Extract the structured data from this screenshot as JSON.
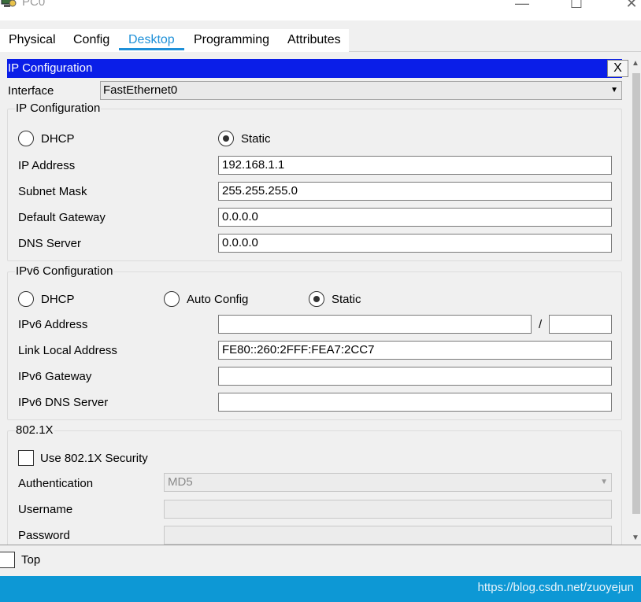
{
  "window": {
    "title": "PC0",
    "minimize_glyph": "—",
    "maximize_glyph": "☐",
    "close_glyph": "✕"
  },
  "tabs": [
    {
      "label": "Physical"
    },
    {
      "label": "Config"
    },
    {
      "label": "Desktop",
      "active": true
    },
    {
      "label": "Programming"
    },
    {
      "label": "Attributes"
    }
  ],
  "panel": {
    "title": "IP Configuration",
    "close_label": "X"
  },
  "interface": {
    "label": "Interface",
    "value": "FastEthernet0"
  },
  "ipv4": {
    "legend": "IP Configuration",
    "dhcp_label": "DHCP",
    "static_label": "Static",
    "mode": "Static",
    "fields": [
      {
        "label": "IP Address",
        "value": "192.168.1.1"
      },
      {
        "label": "Subnet Mask",
        "value": "255.255.255.0"
      },
      {
        "label": "Default Gateway",
        "value": "0.0.0.0"
      },
      {
        "label": "DNS Server",
        "value": "0.0.0.0"
      }
    ]
  },
  "ipv6": {
    "legend": "IPv6 Configuration",
    "dhcp_label": "DHCP",
    "auto_label": "Auto Config",
    "static_label": "Static",
    "mode": "Static",
    "address_label": "IPv6 Address",
    "address_value": "",
    "prefix_separator": "/",
    "prefix_value": "",
    "link_local_label": "Link Local Address",
    "link_local_value": "FE80::260:2FFF:FEA7:2CC7",
    "gateway_label": "IPv6 Gateway",
    "gateway_value": "",
    "dns_label": "IPv6 DNS Server",
    "dns_value": ""
  },
  "dot1x": {
    "legend": "802.1X",
    "use_label": "Use 802.1X Security",
    "use_checked": false,
    "auth_label": "Authentication",
    "auth_value": "MD5",
    "username_label": "Username",
    "username_value": "",
    "password_label": "Password",
    "password_value": ""
  },
  "bottom": {
    "top_label": "Top",
    "top_checked": false
  },
  "footer": {
    "watermark": "https://blog.csdn.net/zuoyejun"
  },
  "colors": {
    "accent": "#1e90d8",
    "panel_header": "#0a1ee8",
    "footer": "#0d98d5"
  }
}
